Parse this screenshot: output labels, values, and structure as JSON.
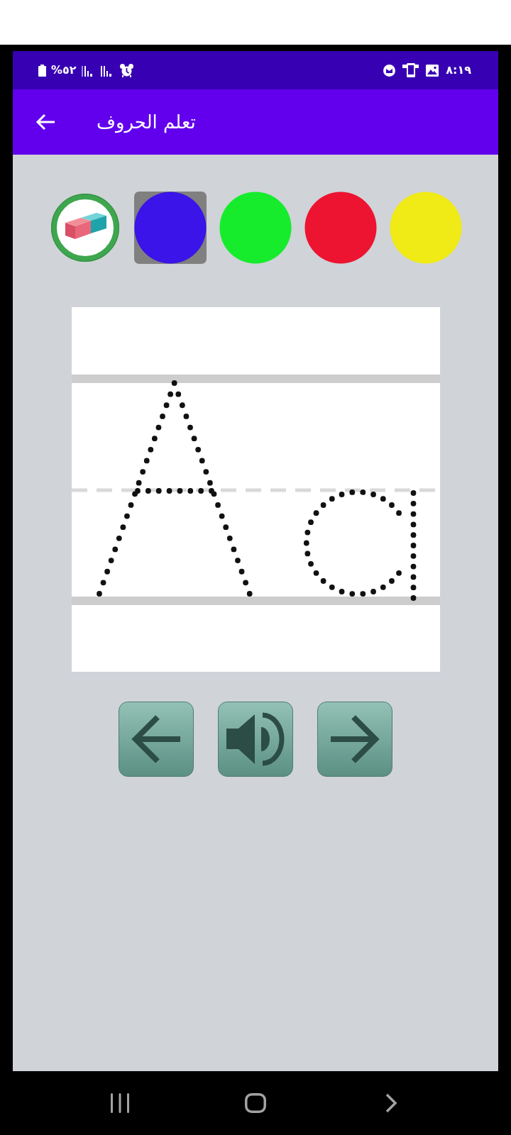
{
  "status_bar": {
    "battery": "%٥٢",
    "time": "٨:١٩"
  },
  "app_bar": {
    "title": "تعلم الحروف"
  },
  "palette": [
    {
      "kind": "eraser",
      "selected": false
    },
    {
      "kind": "color",
      "color": "#3a14e8",
      "selected": true
    },
    {
      "kind": "color",
      "color": "#16ec2c",
      "selected": false
    },
    {
      "kind": "color",
      "color": "#ec1430",
      "selected": false
    },
    {
      "kind": "color",
      "color": "#f0ea16",
      "selected": false
    }
  ],
  "controls": [
    {
      "kind": "previous"
    },
    {
      "kind": "sound"
    },
    {
      "kind": "next"
    }
  ]
}
